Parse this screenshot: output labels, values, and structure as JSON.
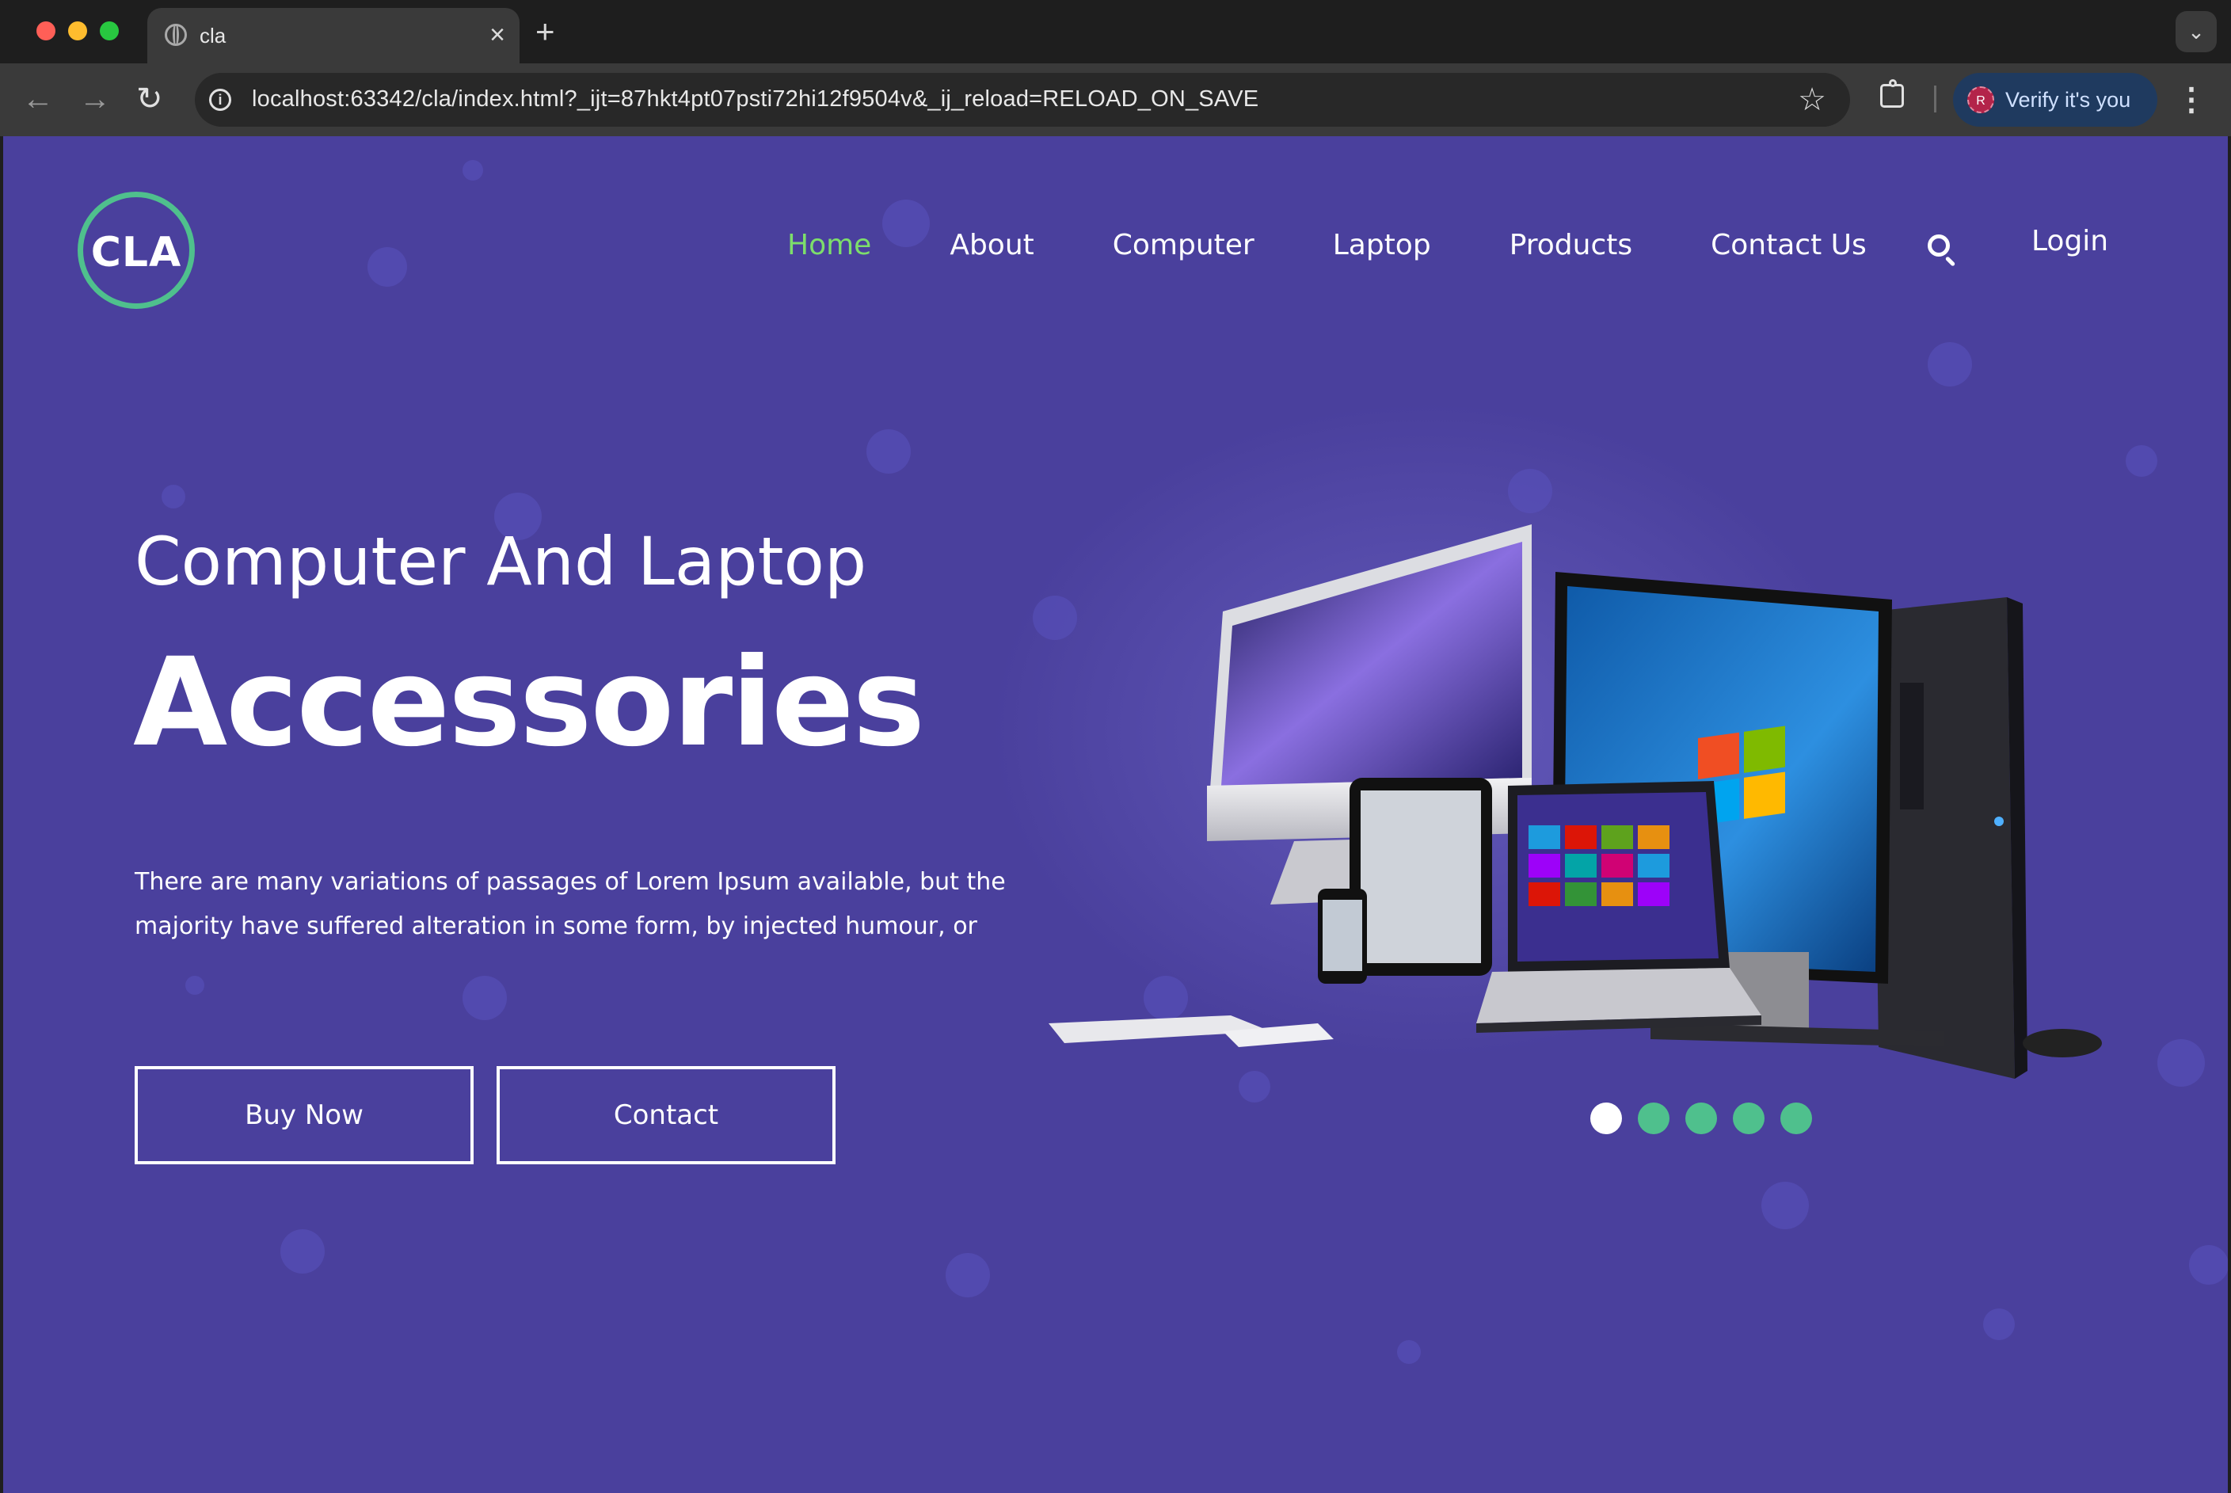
{
  "browser": {
    "tab_title": "cla",
    "tab_close": "×",
    "new_tab": "+",
    "tab_menu": "⌄",
    "url": "localhost:63342/cla/index.html?_ijt=87hkt4pt07psti72hi12f9504v&_ij_reload=RELOAD_ON_SAVE",
    "back": "←",
    "forward": "→",
    "reload": "↻",
    "info": "i",
    "star": "☆",
    "profile_initial": "R",
    "profile_label": "Verify it's you",
    "menu": "⋮"
  },
  "site": {
    "logo_text": "CLA",
    "nav": {
      "home": "Home",
      "about": "About",
      "computer": "Computer",
      "laptop": "Laptop",
      "products": "Products",
      "contact_us": "Contact Us",
      "login": "Login"
    },
    "hero": {
      "subtitle": "Computer And Laptop",
      "title": "Accessories",
      "description": "There are many variations of passages of Lorem Ipsum available, but the majority have suffered alteration in some form, by injected humour, or",
      "buy_label": "Buy Now",
      "contact_label": "Contact"
    },
    "carousel": {
      "slide_count": 5,
      "active_index": 0
    },
    "colors": {
      "background": "#4a409d",
      "accent_green": "#4fc08d",
      "nav_active": "#7dde6b"
    }
  }
}
